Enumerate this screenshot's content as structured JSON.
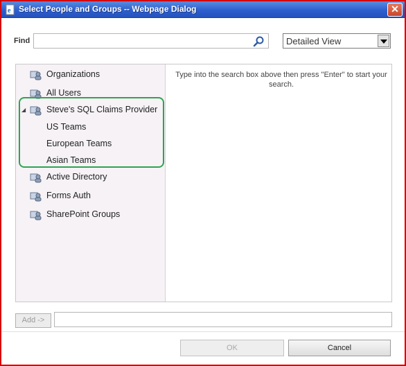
{
  "window": {
    "title": "Select People and Groups -- Webpage Dialog",
    "close_label": "✕"
  },
  "find": {
    "label": "Find",
    "value": "",
    "placeholder": ""
  },
  "view_select": {
    "selected": "Detailed View"
  },
  "tree": {
    "items": [
      {
        "label": "Organizations"
      },
      {
        "label": "All Users"
      },
      {
        "label": "Steve's SQL Claims Provider",
        "expanded": true,
        "children": [
          "US Teams",
          "European Teams",
          "Asian Teams"
        ]
      },
      {
        "label": "Active Directory"
      },
      {
        "label": "Forms Auth"
      },
      {
        "label": "SharePoint Groups"
      }
    ]
  },
  "results": {
    "hint": "Type into the search box above then press \"Enter\" to start your search."
  },
  "footer": {
    "add_label": "Add ->",
    "ok_label": "OK",
    "cancel_label": "Cancel"
  },
  "colors": {
    "titlebar": "#2d5fcf",
    "highlight_frame": "#d40000",
    "group_highlight": "#2ea44f",
    "tree_background": "#f6f2f6"
  },
  "icons": {
    "title": "ie-page-icon",
    "search": "magnifier-icon",
    "tree_node": "people-directory-icon",
    "expander": "triangle-expanded-icon"
  }
}
